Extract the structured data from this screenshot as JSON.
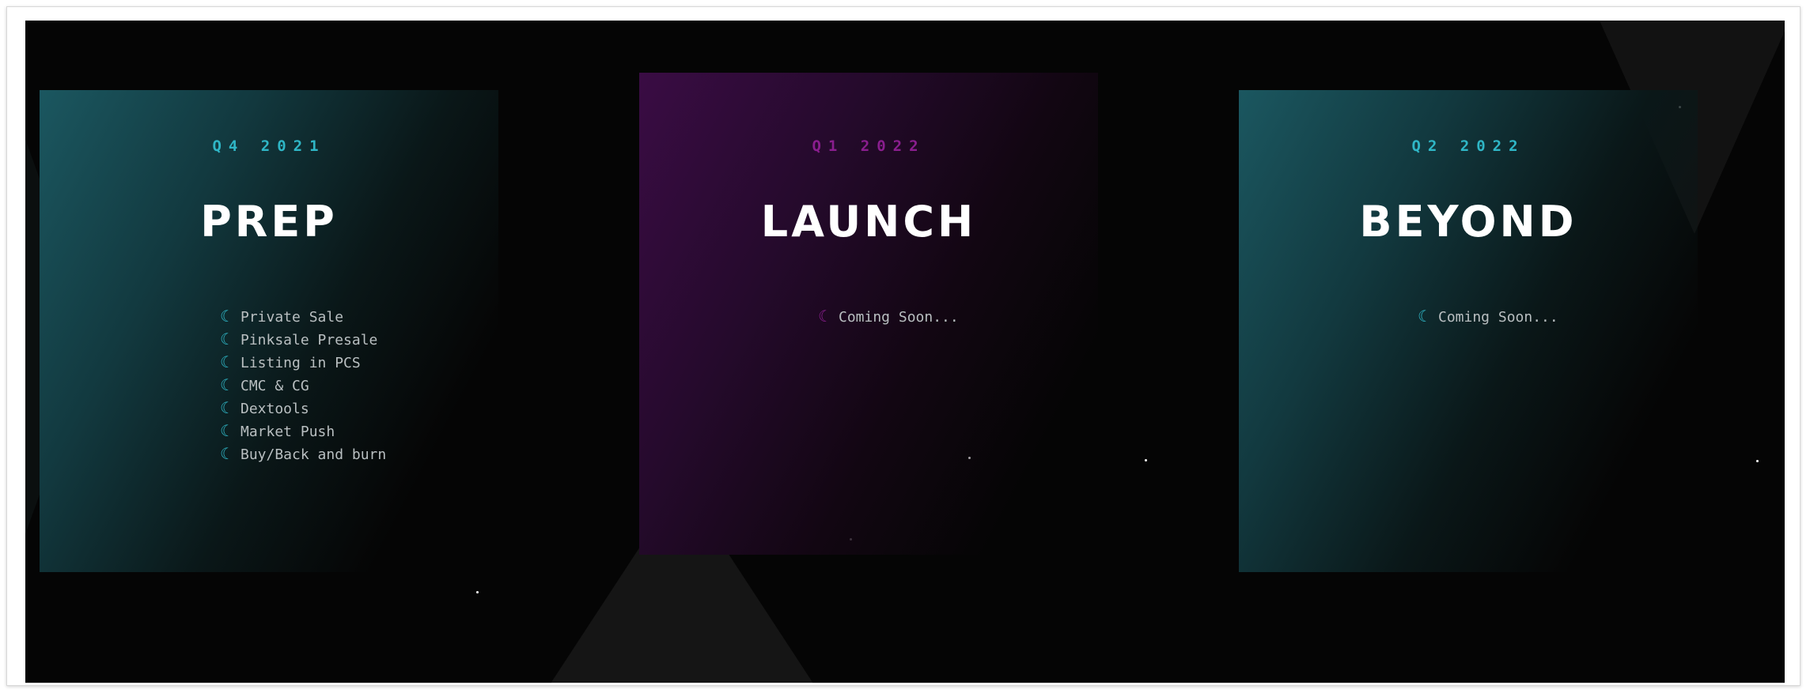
{
  "colors": {
    "background": "#050505",
    "teal_accent": "#2fb6c6",
    "purple_accent": "#8a1e8e",
    "item_text": "#b9bfc1"
  },
  "roadmap": {
    "phases": [
      {
        "quarter": "Q4 2021",
        "title": "PREP",
        "icon": "moon-icon",
        "items": [
          "Private Sale",
          "Pinksale Presale",
          "Listing in PCS",
          "CMC & CG",
          "Dextools",
          "Market Push",
          "Buy/Back and burn"
        ]
      },
      {
        "quarter": "Q1 2022",
        "title": "LAUNCH",
        "icon": "moon-icon",
        "items": [
          "Coming Soon..."
        ]
      },
      {
        "quarter": "Q2 2022",
        "title": "BEYOND",
        "icon": "moon-icon",
        "items": [
          "Coming Soon..."
        ]
      }
    ]
  }
}
